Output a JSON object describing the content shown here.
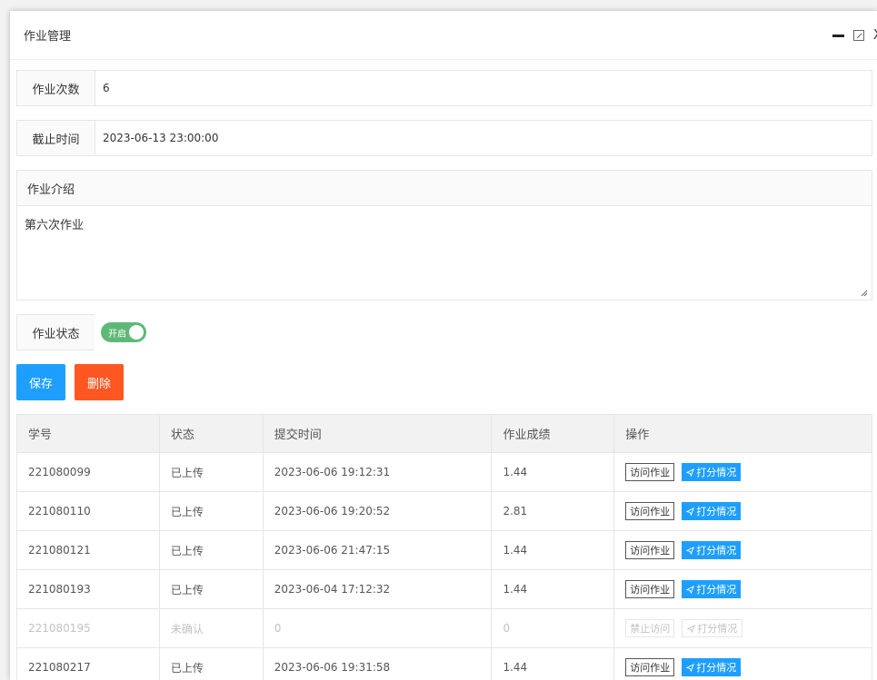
{
  "window": {
    "title": "作业管理",
    "minimize_icon": "minimize-icon",
    "maximize_icon": "maximize-icon",
    "close_label": "X"
  },
  "form": {
    "count_label": "作业次数",
    "count_value": "6",
    "deadline_label": "截止时间",
    "deadline_value": "2023-06-13 23:00:00",
    "intro_label": "作业介绍",
    "intro_value": "第六次作业",
    "status_label": "作业状态",
    "status_switch_text": "开启",
    "status_on": true
  },
  "buttons": {
    "save": "保存",
    "delete": "删除"
  },
  "colors": {
    "primary": "#1e9fff",
    "danger": "#ff5722",
    "switch_on": "#5fb878"
  },
  "table": {
    "headers": [
      "学号",
      "状态",
      "提交时间",
      "作业成绩",
      "操作"
    ],
    "rows": [
      {
        "id": "221080099",
        "status": "已上传",
        "time": "2023-06-06 19:12:31",
        "score": "1.44",
        "visit": "访问作业",
        "grade": "打分情况",
        "disabled": false
      },
      {
        "id": "221080110",
        "status": "已上传",
        "time": "2023-06-06 19:20:52",
        "score": "2.81",
        "visit": "访问作业",
        "grade": "打分情况",
        "disabled": false
      },
      {
        "id": "221080121",
        "status": "已上传",
        "time": "2023-06-06 21:47:15",
        "score": "1.44",
        "visit": "访问作业",
        "grade": "打分情况",
        "disabled": false
      },
      {
        "id": "221080193",
        "status": "已上传",
        "time": "2023-06-04 17:12:32",
        "score": "1.44",
        "visit": "访问作业",
        "grade": "打分情况",
        "disabled": false
      },
      {
        "id": "221080195",
        "status": "未确认",
        "time": "0",
        "score": "0",
        "visit": "禁止访问",
        "grade": "打分情况",
        "disabled": true
      },
      {
        "id": "221080217",
        "status": "已上传",
        "time": "2023-06-06 19:31:58",
        "score": "1.44",
        "visit": "访问作业",
        "grade": "打分情况",
        "disabled": false
      }
    ]
  }
}
